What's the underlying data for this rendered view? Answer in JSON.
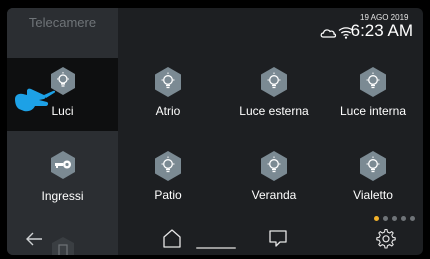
{
  "sidebar": {
    "top_label": "Telecamere",
    "items": [
      {
        "label": "Luci",
        "icon": "lightbulb-icon",
        "active": true
      },
      {
        "label": "Ingressi",
        "icon": "door-key-icon",
        "active": false
      }
    ]
  },
  "header": {
    "date": "19 AGO 2019",
    "time": "6:23 AM",
    "status_icons": [
      "cloud-icon",
      "wifi-icon"
    ]
  },
  "tiles": [
    {
      "label": "Atrio",
      "icon": "lightbulb-icon"
    },
    {
      "label": "Luce esterna",
      "icon": "lightbulb-icon"
    },
    {
      "label": "Luce interna",
      "icon": "lightbulb-icon"
    },
    {
      "label": "Patio",
      "icon": "lightbulb-icon"
    },
    {
      "label": "Veranda",
      "icon": "lightbulb-icon"
    },
    {
      "label": "Vialetto",
      "icon": "lightbulb-icon"
    }
  ],
  "pager": {
    "pages": 5,
    "current": 1
  },
  "bottom_bar": {
    "icons": [
      "back-arrow-icon",
      "home-icon",
      "chat-icon",
      "settings-icon"
    ]
  },
  "colors": {
    "accent": "#f2b12a",
    "tile_icon_bg": "#7b8a93",
    "active_bg": "#0e0f10",
    "hand": "#1da1e6"
  }
}
